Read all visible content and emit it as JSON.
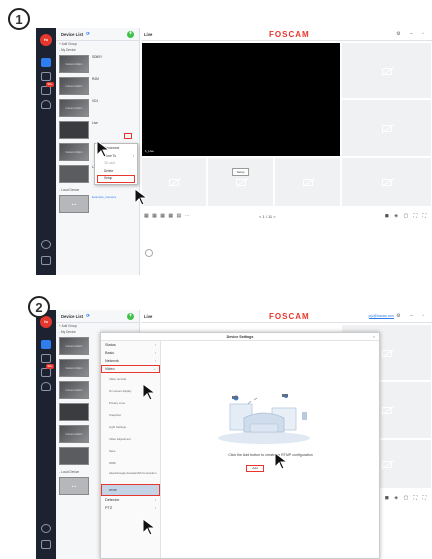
{
  "steps": [
    "1",
    "2"
  ],
  "app": {
    "device_list_title": "Device List",
    "live_title": "Live",
    "brand": "FOSCAM",
    "user_email": "jojo@foscam.com",
    "logo_text": "fo",
    "alert_count": "99+"
  },
  "device_list": {
    "add_group": "+ Add Group",
    "my_device": "- My Device",
    "local_device": "- Local Device",
    "cameras": [
      {
        "name": "SD80Y",
        "thumb": "Camera Option",
        "status": ""
      },
      {
        "name": "R4M",
        "thumb": "Camera Option",
        "status": ""
      },
      {
        "name": "VD1",
        "thumb": "Camera Option",
        "status": ""
      },
      {
        "name": "Live",
        "thumb": "",
        "status": ""
      },
      {
        "name": "",
        "thumb": "Camera Option",
        "status": ""
      },
      {
        "name": "Lab",
        "thumb": "",
        "status": ""
      }
    ],
    "local_cam": {
      "name": "Example_Camera",
      "thumb": ""
    }
  },
  "context_menu": {
    "items": [
      "Reconnect",
      "Move To",
      "3D card",
      "Delete",
      "Setup"
    ]
  },
  "grid": {
    "live_tile_name": "1_Live",
    "tile_button": "Setup"
  },
  "bottom": {
    "pager": "< 1 / 11 >",
    "layouts": "▦ ▦ ▦ ▦ ▤ ⋯",
    "tools": "◼ ◈ ▢ ⛶ ⛶"
  },
  "dialog": {
    "title": "Device Settings",
    "close": "×",
    "nav": [
      "Status",
      "Basic",
      "Network",
      "Video"
    ],
    "video_sub": [
      "Video records",
      "On screen display",
      "Privacy zone",
      "Snapshot",
      "Light Settings",
      "Video Adjustment",
      "Save",
      "WDR",
      "Alexa/Google Assistant/Mi Connection",
      "RTMP"
    ],
    "nav_after": [
      "Detector",
      "PTZ"
    ],
    "message": "Click the Add button to create an RTMP configuration",
    "add_button": "Add"
  },
  "colors": {
    "accent_red": "#e6372e",
    "accent_blue": "#2f7ef0",
    "rail": "#1d2230"
  }
}
